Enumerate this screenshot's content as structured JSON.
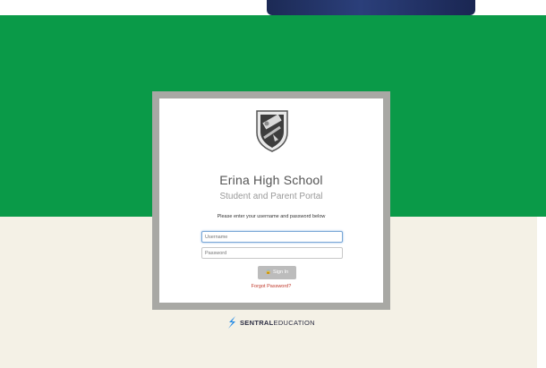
{
  "school": {
    "name": "Erina High School",
    "portal": "Student and Parent Portal"
  },
  "login": {
    "instructions": "Please enter your username and password below",
    "username_placeholder": "Username",
    "password_placeholder": "Password",
    "signin_label": "Sign In",
    "forgot_label": "Forgot Password?"
  },
  "footer": {
    "brand_bold": "SENTRAL",
    "brand_light": "EDUCATION"
  },
  "icons": {
    "crest": "school-crest-icon",
    "lock": "lock-icon",
    "brand_logo": "sentral-logo-icon"
  },
  "colors": {
    "green": "#0a9a48",
    "cream": "#f4f1e6",
    "frame": "#a8a8a4",
    "link": "#c0392b",
    "brand_blue": "#1e88e5"
  }
}
